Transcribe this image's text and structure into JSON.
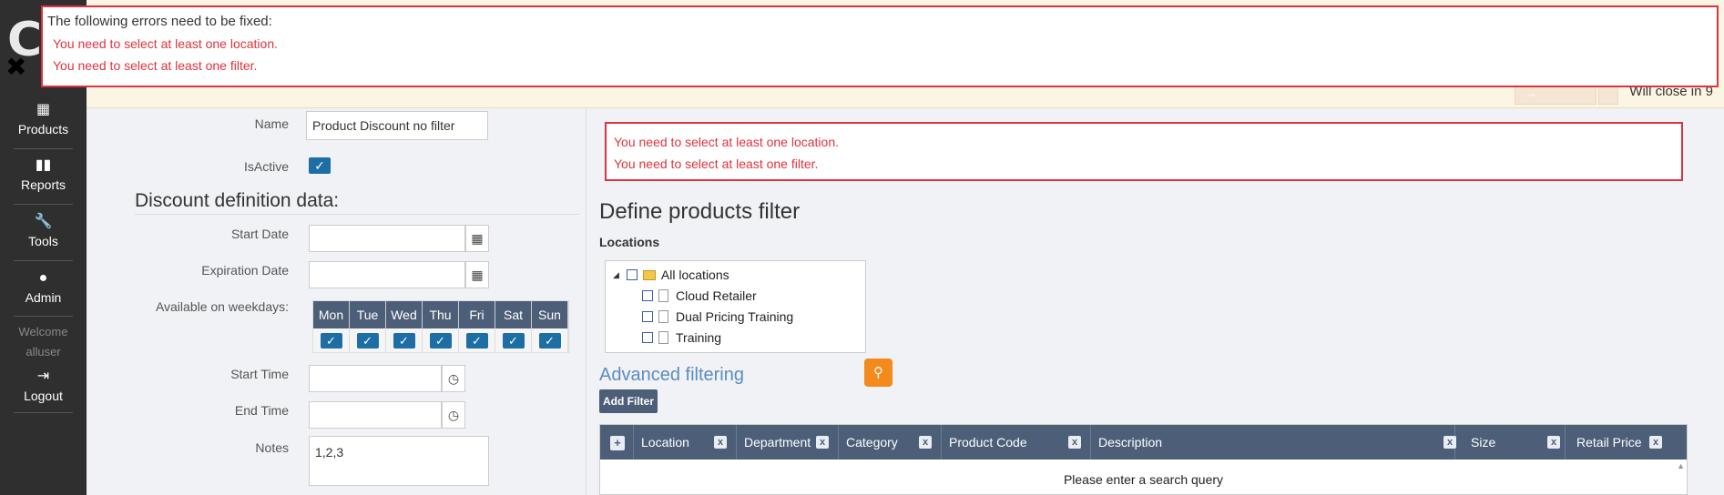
{
  "sidebar": {
    "logo": "C",
    "items": [
      {
        "label": "Products",
        "icon": "boxes-icon"
      },
      {
        "label": "Reports",
        "icon": "bar-chart-icon"
      },
      {
        "label": "Tools",
        "icon": "wrench-icon"
      },
      {
        "label": "Admin",
        "icon": "user-icon"
      },
      {
        "label": "Logout",
        "icon": "sign-out-icon"
      }
    ],
    "welcome": "Welcome",
    "username": "alluser"
  },
  "notification": {
    "title": "The following errors need to be fixed:",
    "errors": [
      "You need to select at least one location.",
      "You need to select at least one filter."
    ],
    "will_close": "Will close in 9"
  },
  "form": {
    "name_label": "Name",
    "name_value": "Product Discount no filter",
    "isactive_label": "IsActive",
    "section_title": "Discount definition data:",
    "start_date_label": "Start Date",
    "expiration_date_label": "Expiration Date",
    "weekdays_label": "Available on weekdays:",
    "weekdays": [
      "Mon",
      "Tue",
      "Wed",
      "Thu",
      "Fri",
      "Sat",
      "Sun"
    ],
    "start_time_label": "Start Time",
    "end_time_label": "End Time",
    "notes_label": "Notes",
    "notes_value": "1,2,3"
  },
  "filter": {
    "errors": [
      "You need to select at least one location.",
      "You need to select at least one filter."
    ],
    "title": "Define products filter",
    "locations_label": "Locations",
    "locations": {
      "root": "All locations",
      "children": [
        "Cloud Retailer",
        "Dual Pricing Training",
        "Training"
      ]
    },
    "advanced_title": "Advanced filtering",
    "add_filter_label": "Add Filter",
    "columns": [
      "Location",
      "Department",
      "Category",
      "Product Code",
      "Description",
      "Size",
      "Retail Price"
    ],
    "empty_message": "Please enter a search query"
  },
  "colors": {
    "sidebar_bg": "#2f2f2f",
    "error": "#e0323c",
    "header_blue": "#4d5f78",
    "checkbox_blue": "#1e6ea6",
    "search_orange": "#f38a1b"
  }
}
